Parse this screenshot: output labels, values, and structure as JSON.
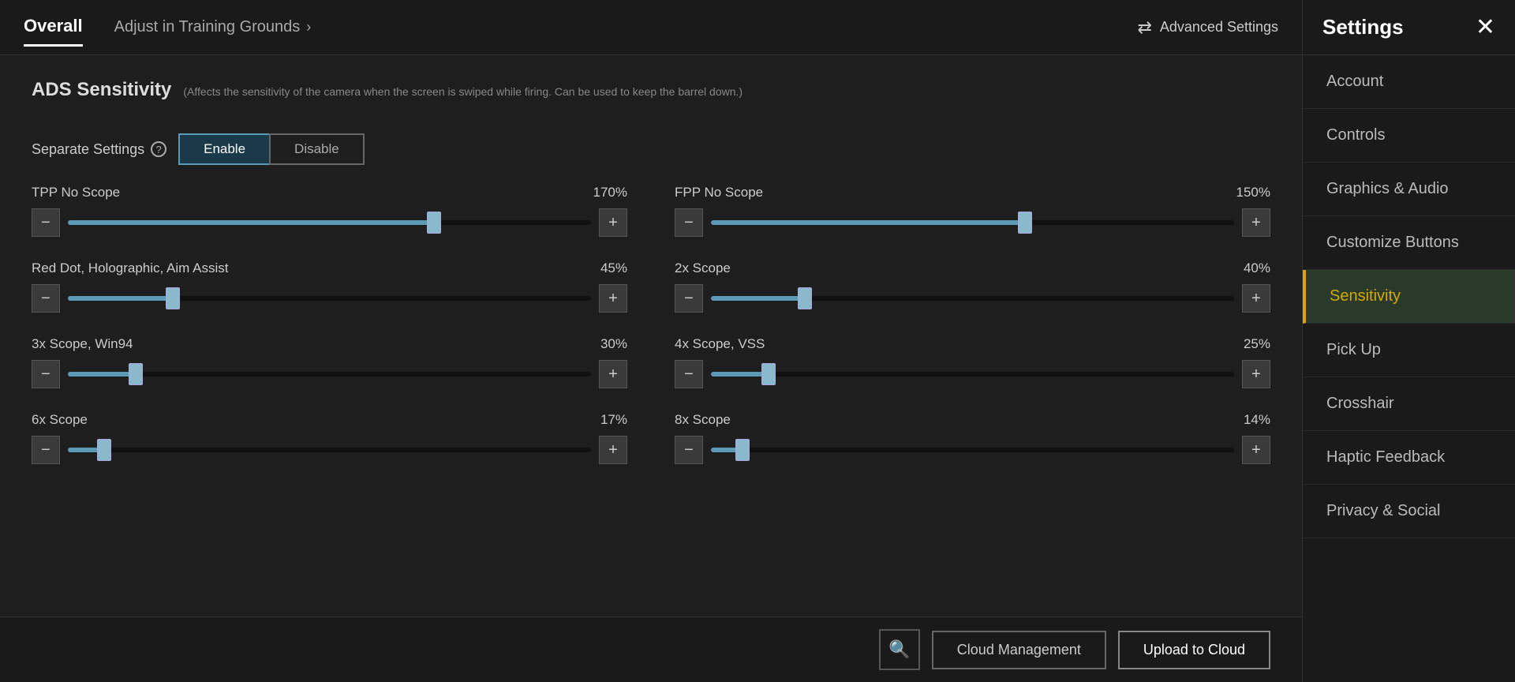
{
  "header": {
    "tab_overall": "Overall",
    "tab_training": "Adjust in Training Grounds",
    "advanced_settings": "Advanced Settings"
  },
  "ads_section": {
    "title": "ADS Sensitivity",
    "description": "(Affects the sensitivity of the camera when the screen is swiped while firing. Can be used to keep the barrel down.)",
    "separate_settings_label": "Separate Settings",
    "enable_label": "Enable",
    "disable_label": "Disable"
  },
  "sliders": [
    {
      "label": "TPP No Scope",
      "value": "170%",
      "percent": 70,
      "side": "left"
    },
    {
      "label": "FPP No Scope",
      "value": "150%",
      "percent": 60,
      "side": "right"
    },
    {
      "label": "Red Dot, Holographic, Aim Assist",
      "value": "45%",
      "percent": 20,
      "side": "left"
    },
    {
      "label": "2x Scope",
      "value": "40%",
      "percent": 18,
      "side": "right"
    },
    {
      "label": "3x Scope, Win94",
      "value": "30%",
      "percent": 13,
      "side": "left"
    },
    {
      "label": "4x Scope, VSS",
      "value": "25%",
      "percent": 11,
      "side": "right"
    },
    {
      "label": "6x Scope",
      "value": "17%",
      "percent": 7,
      "side": "left"
    },
    {
      "label": "8x Scope",
      "value": "14%",
      "percent": 6,
      "side": "right"
    }
  ],
  "bottom_bar": {
    "search_icon": "🔍",
    "cloud_management": "Cloud Management",
    "upload_to_cloud": "Upload to Cloud"
  },
  "sidebar": {
    "title": "Settings",
    "close_icon": "✕",
    "items": [
      {
        "label": "Account",
        "active": false
      },
      {
        "label": "Controls",
        "active": false
      },
      {
        "label": "Graphics & Audio",
        "active": false
      },
      {
        "label": "Customize Buttons",
        "active": false
      },
      {
        "label": "Sensitivity",
        "active": true
      },
      {
        "label": "Pick Up",
        "active": false
      },
      {
        "label": "Crosshair",
        "active": false
      },
      {
        "label": "Haptic Feedback",
        "active": false
      },
      {
        "label": "Privacy & Social",
        "active": false
      }
    ]
  }
}
